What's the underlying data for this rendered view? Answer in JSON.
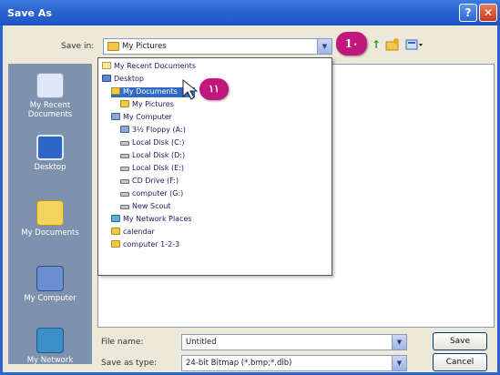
{
  "window": {
    "title": "Save As",
    "help_icon": "?",
    "close_icon": "✕"
  },
  "save_in": {
    "label": "Save in:",
    "value": "My Pictures",
    "arrow_icon": "▼"
  },
  "toolbar": {
    "back_icon": "back-arrow",
    "up_icon": "↑",
    "new_folder_icon": "new-folder",
    "views_icon": "views-menu"
  },
  "annotations": {
    "badge_toolbar": "1۰",
    "badge_list": "۱۱"
  },
  "places": [
    {
      "label": "My Recent Documents",
      "color": "#dfe8f6"
    },
    {
      "label": "Desktop",
      "color": "#2e66c8"
    },
    {
      "label": "My Documents",
      "color": "#f2d35c"
    },
    {
      "label": "My Computer",
      "color": "#6b8fd0"
    },
    {
      "label": "My Network",
      "color": "#3a8fc7"
    }
  ],
  "dropdown_items": [
    {
      "label": "My Recent Documents",
      "icon": "document-icon",
      "indent": 0
    },
    {
      "label": "Desktop",
      "icon": "desktop-icon",
      "indent": 0
    },
    {
      "label": "My Documents",
      "icon": "folder-icon",
      "indent": 1,
      "selected": true
    },
    {
      "label": "My Pictures",
      "icon": "folder-icon",
      "indent": 2
    },
    {
      "label": "My Computer",
      "icon": "computer-icon",
      "indent": 1
    },
    {
      "label": "3½ Floppy (A:)",
      "icon": "floppy-icon",
      "indent": 2
    },
    {
      "label": "Local Disk (C:)",
      "icon": "drive-icon",
      "indent": 2
    },
    {
      "label": "Local Disk (D:)",
      "icon": "drive-icon",
      "indent": 2
    },
    {
      "label": "Local Disk (E:)",
      "icon": "drive-icon",
      "indent": 2
    },
    {
      "label": "CD Drive (F:)",
      "icon": "cd-icon",
      "indent": 2
    },
    {
      "label": "computer (G:)",
      "icon": "drive-icon",
      "indent": 2
    },
    {
      "label": "New Scout",
      "icon": "drive-icon",
      "indent": 2
    },
    {
      "label": "My Network Places",
      "icon": "network-icon",
      "indent": 1
    },
    {
      "label": "calendar",
      "icon": "folder-icon",
      "indent": 1
    },
    {
      "label": "computer 1-2-3",
      "icon": "folder-icon",
      "indent": 1
    }
  ],
  "file_name": {
    "label": "File name:",
    "value": "Untitled"
  },
  "save_as_type": {
    "label": "Save as type:",
    "value": "24-bit Bitmap (*.bmp;*.dib)"
  },
  "buttons": {
    "save": "Save",
    "cancel": "Cancel"
  }
}
